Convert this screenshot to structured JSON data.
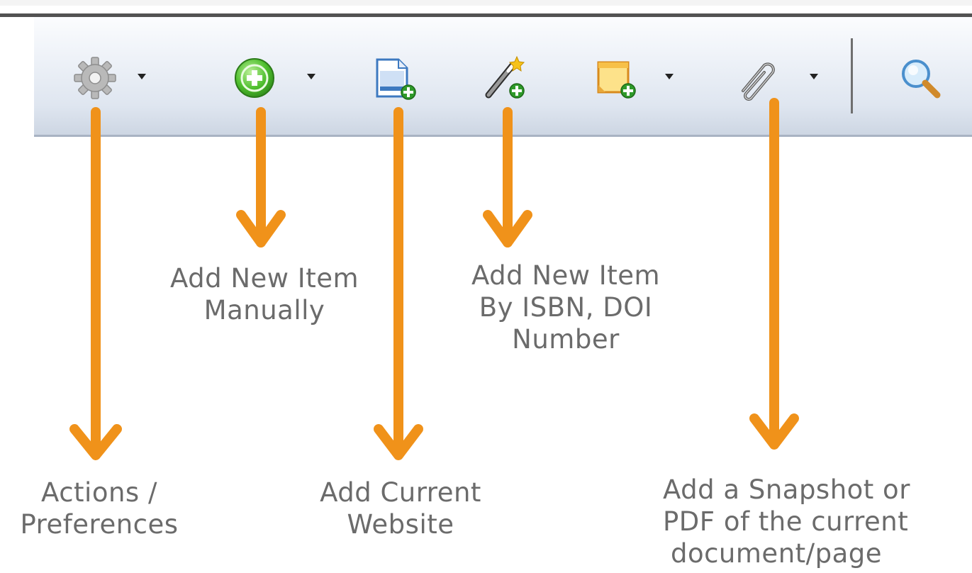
{
  "toolbar": {
    "items": [
      {
        "icon": "gear-icon",
        "has_dropdown": true
      },
      {
        "icon": "add-circle-icon",
        "has_dropdown": true
      },
      {
        "icon": "add-page-icon",
        "has_dropdown": false
      },
      {
        "icon": "magic-wand-icon",
        "has_dropdown": false
      },
      {
        "icon": "add-note-icon",
        "has_dropdown": true
      },
      {
        "icon": "paperclip-icon",
        "has_dropdown": true
      },
      {
        "icon": "search-icon",
        "has_dropdown": false
      }
    ]
  },
  "annotations": {
    "actions": [
      "Actions /",
      "Preferences"
    ],
    "add_manually": [
      "Add New Item",
      "Manually"
    ],
    "add_website": [
      "Add Current",
      "Website"
    ],
    "add_by_id": [
      "Add New Item",
      "By ISBN, DOI",
      "Number"
    ],
    "add_snapshot": [
      "Add a Snapshot or",
      "PDF of the current",
      "document/page"
    ]
  },
  "colors": {
    "arrow": "#f0921a",
    "label_text": "#6b6b6b",
    "toolbar_top": "#fbfcfe",
    "toolbar_bottom": "#cdd6e3"
  }
}
